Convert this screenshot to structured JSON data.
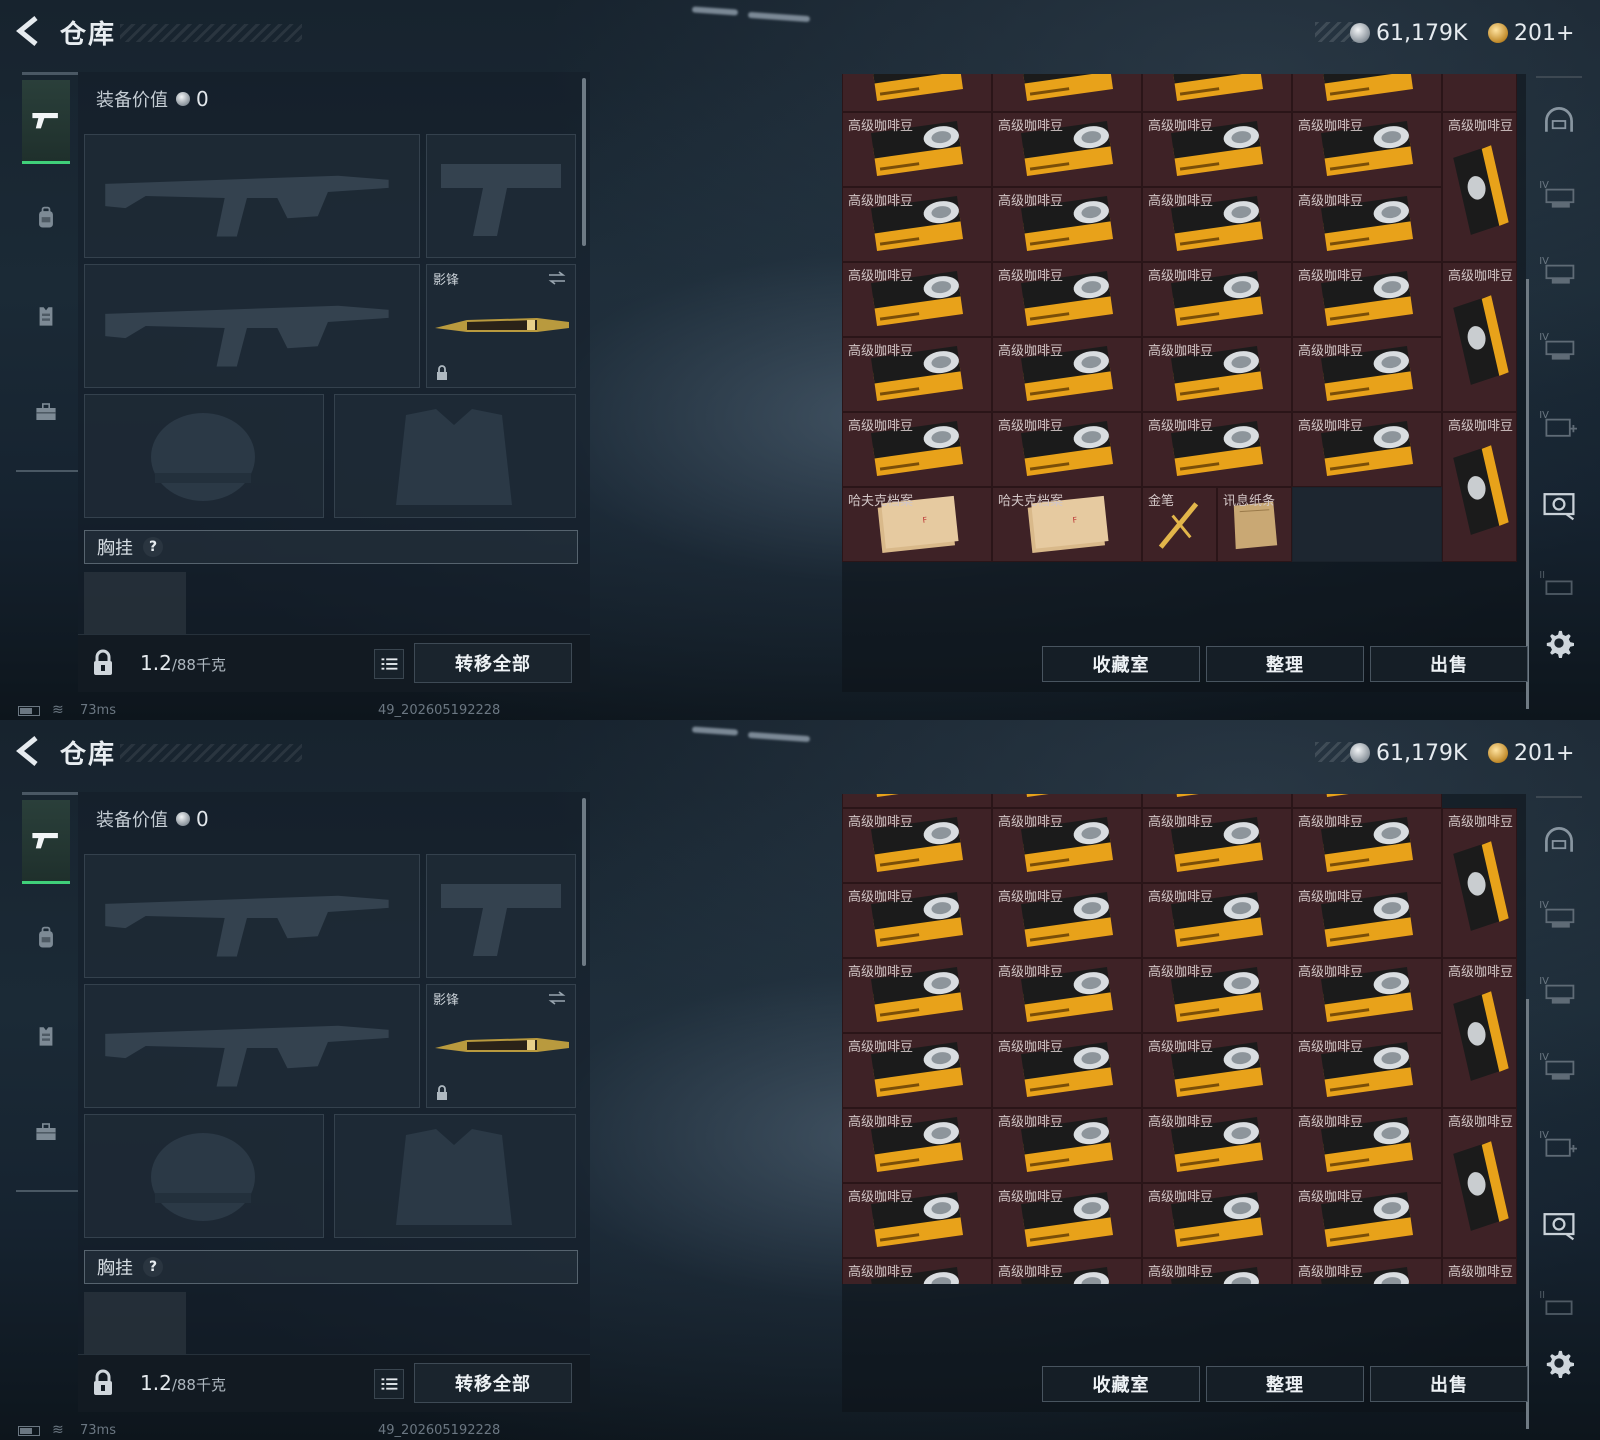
{
  "screens": [
    {
      "header": {
        "title": "仓库",
        "currency_silver": "61,179K",
        "currency_gold": "201+"
      },
      "loadout": {
        "value_label": "装备价值",
        "value": "0",
        "knife_name": "影锋",
        "chest_rig_label": "胸挂",
        "chest_help": "?",
        "weight_value": "1.2",
        "weight_unit": "/88千克",
        "transfer_all": "转移全部"
      },
      "status": {
        "ping": "73ms",
        "version": "49_202605192228"
      },
      "actions": {
        "collection": "收藏室",
        "sort": "整理",
        "sell": "出售"
      },
      "storage": {
        "item_name_coffee": "高级咖啡豆",
        "top_row_partial": true,
        "rows_coffee": 5,
        "bottom_items": [
          "哈夫克档案",
          "哈夫克档案",
          "金笔",
          "讯息纸条"
        ]
      }
    },
    {
      "header": {
        "title": "仓库",
        "currency_silver": "61,179K",
        "currency_gold": "201+"
      },
      "loadout": {
        "value_label": "装备价值",
        "value": "0",
        "knife_name": "影锋",
        "chest_rig_label": "胸挂",
        "chest_help": "?",
        "weight_value": "1.2",
        "weight_unit": "/88千克",
        "transfer_all": "转移全部"
      },
      "status": {
        "ping": "73ms",
        "version": "49_202605192228"
      },
      "actions": {
        "collection": "收藏室",
        "sort": "整理",
        "sell": "出售"
      },
      "storage": {
        "item_name_coffee": "高级咖啡豆",
        "top_row_partial": true,
        "rows_coffee": 7,
        "bottom_items": []
      }
    }
  ],
  "colors": {
    "accent_green": "#40d07a",
    "item_bg": "#3e2226",
    "coffee_orange": "#e8a21a"
  },
  "icons": [
    "back-arrow-icon",
    "silver-coin-icon",
    "gold-coin-icon",
    "pistol-icon",
    "backpack-icon",
    "vest-icon",
    "toolbox-icon",
    "lock-icon",
    "list-icon",
    "swap-icon",
    "help-icon",
    "helmet-rack-icon",
    "armor-rack-icon",
    "settings-gear-icon",
    "battery-icon",
    "wifi-icon"
  ]
}
